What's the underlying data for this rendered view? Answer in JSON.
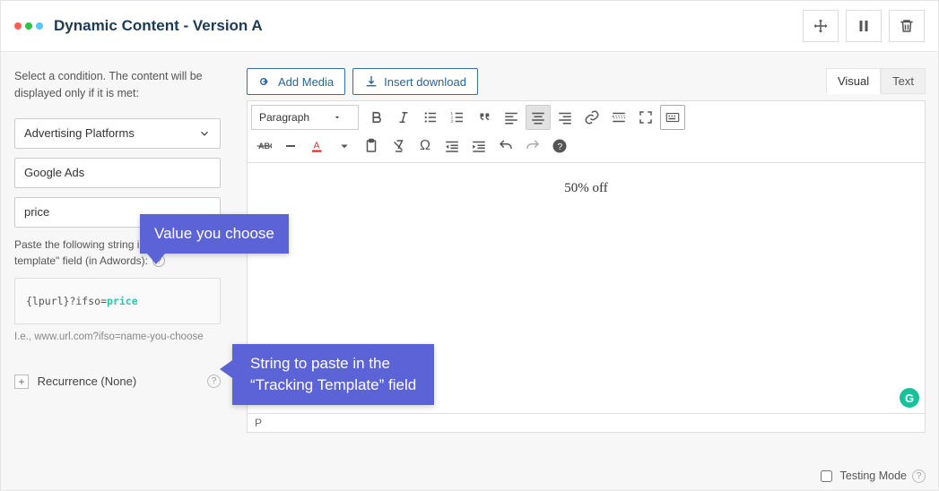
{
  "header": {
    "title": "Dynamic Content - Version A"
  },
  "sidebar": {
    "description": "Select a condition. The content will be displayed only if it is met:",
    "condition_type": "Advertising Platforms",
    "platform": "Google Ads",
    "value": "price",
    "helper": "Paste the following string into the \"tracking template\" field (in Adwords):",
    "code_prefix": "{lpurl}?ifso=",
    "code_value": "price",
    "example": "I.e., www.url.com?ifso=name-you-choose",
    "recurrence_label": "Recurrence (None)"
  },
  "editor": {
    "add_media": "Add Media",
    "insert_download": "Insert download",
    "tab_visual": "Visual",
    "tab_text": "Text",
    "format": "Paragraph",
    "content": "50% off",
    "path": "P"
  },
  "footer": {
    "testing_mode": "Testing Mode"
  },
  "callouts": {
    "c1": "Value you choose",
    "c2_line1": "String to paste in the",
    "c2_line2": "“Tracking Template” field"
  }
}
